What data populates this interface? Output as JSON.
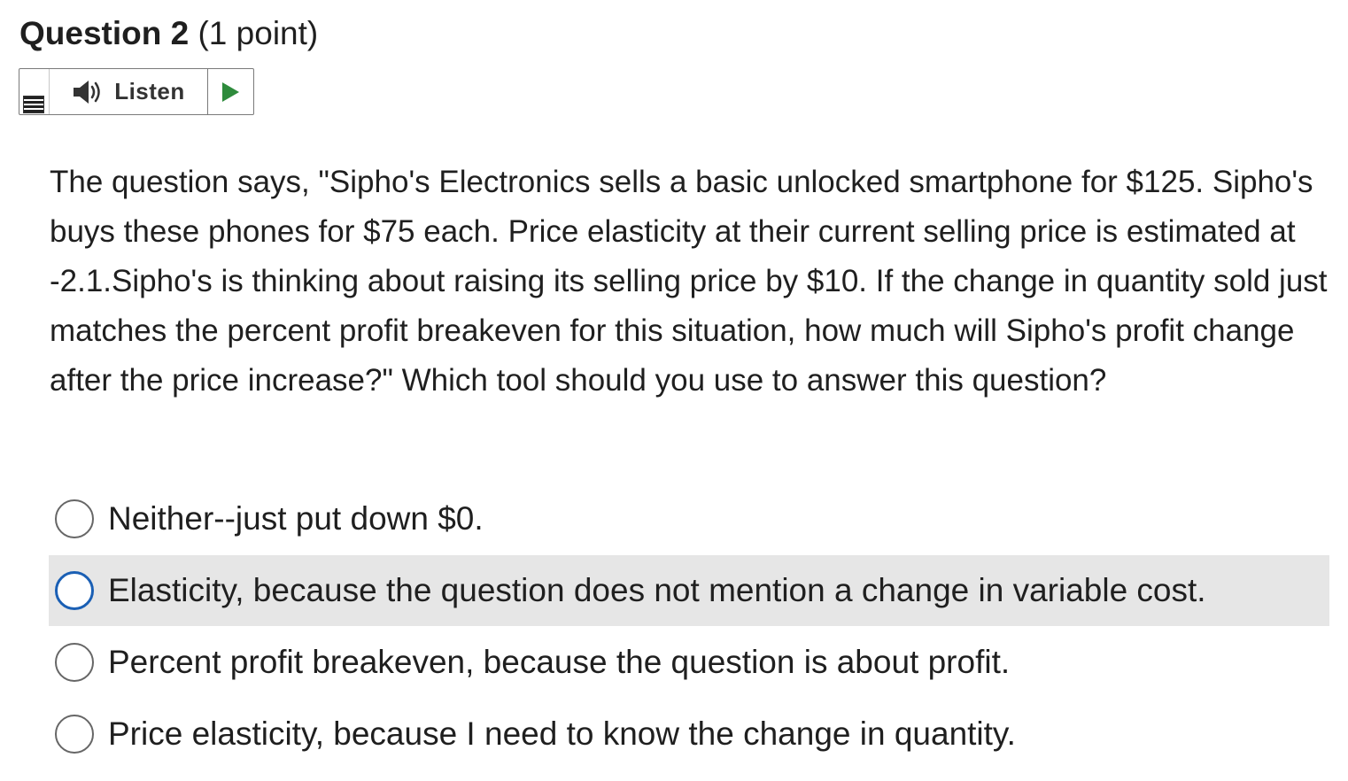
{
  "question": {
    "title": "Question 2",
    "points": "(1 point)",
    "text": "The question says, \"Sipho's Electronics sells a basic unlocked smartphone for $125. Sipho's buys these phones for $75 each. Price elasticity at their current selling price is estimated at -2.1.Sipho's is thinking about raising its selling price by $10. If the change in quantity sold just matches the percent profit breakeven for this situation, how much will Sipho's profit change after the price increase?\" Which tool should you use to answer this question?"
  },
  "listen": {
    "label": "Listen",
    "menu_icon": "menu-icon",
    "speaker_icon": "speaker-icon",
    "play_icon": "play-icon",
    "play_color": "#2e8b3c"
  },
  "options": [
    {
      "label": "Neither--just put down $0."
    },
    {
      "label": "Elasticity, because the question does not mention a change in variable cost."
    },
    {
      "label": "Percent profit breakeven, because the question is about profit."
    },
    {
      "label": "Price elasticity, because I need to know the change in quantity."
    }
  ],
  "colors": {
    "focus_ring": "#1a5fb4",
    "hover_row": "#e6e6e6"
  }
}
